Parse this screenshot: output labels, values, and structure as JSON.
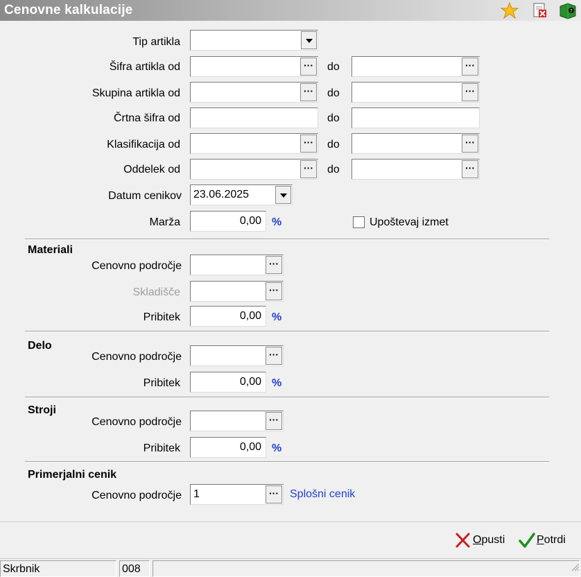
{
  "window": {
    "title": "Cenovne kalkulacije"
  },
  "toolbar_icons": [
    "star-icon",
    "close-document-icon",
    "help-book-icon"
  ],
  "fields": {
    "tip_artikla": {
      "label": "Tip artikla",
      "value": ""
    },
    "sifra_artikla": {
      "label": "Šifra artikla od",
      "from": "",
      "to_label": "do",
      "to": ""
    },
    "skupina_artikla": {
      "label": "Skupina artikla od",
      "from": "",
      "to_label": "do",
      "to": ""
    },
    "crtna_sifra": {
      "label": "Črtna šifra od",
      "from": "",
      "to_label": "do",
      "to": ""
    },
    "klasifikacija": {
      "label": "Klasifikacija od",
      "from": "",
      "to_label": "do",
      "to": ""
    },
    "oddelek": {
      "label": "Oddelek od",
      "from": "",
      "to_label": "do",
      "to": ""
    },
    "datum_cenikov": {
      "label": "Datum cenikov",
      "value": "23.06.2025"
    },
    "marza": {
      "label": "Marža",
      "value": "0,00",
      "unit": "%"
    },
    "upostevaj_izmet": {
      "label": "Upoštevaj izmet",
      "checked": false
    }
  },
  "materiali": {
    "title": "Materiali",
    "cenovno_podrocje": {
      "label": "Cenovno področje",
      "value": ""
    },
    "skladisce": {
      "label": "Skladišče",
      "value": ""
    },
    "pribitek": {
      "label": "Pribitek",
      "value": "0,00",
      "unit": "%"
    }
  },
  "delo": {
    "title": "Delo",
    "cenovno_podrocje": {
      "label": "Cenovno področje",
      "value": ""
    },
    "pribitek": {
      "label": "Pribitek",
      "value": "0,00",
      "unit": "%"
    }
  },
  "stroji": {
    "title": "Stroji",
    "cenovno_podrocje": {
      "label": "Cenovno področje",
      "value": ""
    },
    "pribitek": {
      "label": "Pribitek",
      "value": "0,00",
      "unit": "%"
    }
  },
  "primerjalni": {
    "title": "Primerjalni cenik",
    "cenovno_podrocje": {
      "label": "Cenovno področje",
      "value": "1",
      "description": "Splošni cenik"
    }
  },
  "buttons": {
    "opusti": {
      "underline": "O",
      "rest": "pusti"
    },
    "potrdi": {
      "underline": "P",
      "rest": "otrdi"
    }
  },
  "ellipsis": "···",
  "status": {
    "user": "Skrbnik",
    "code": "008",
    "extra": ""
  },
  "colors": {
    "accent": "#1f3fd0",
    "titlebar_start": "#8a8a8a",
    "titlebar_end": "#ececec"
  }
}
